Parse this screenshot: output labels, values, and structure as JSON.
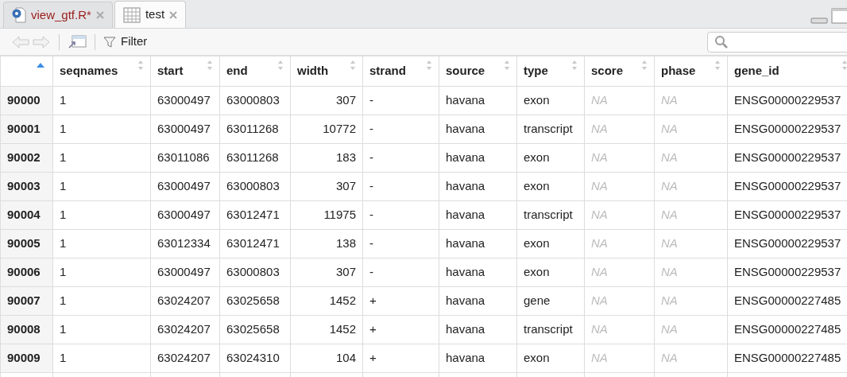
{
  "tabs": [
    {
      "kind": "script",
      "label": "view_gtf.R*",
      "selected": false
    },
    {
      "kind": "table",
      "label": "test",
      "selected": true
    }
  ],
  "toolbar": {
    "filter_label": "Filter"
  },
  "table": {
    "sorted_ascending": true,
    "columns": [
      {
        "label": "seqnames",
        "kind": "text"
      },
      {
        "label": "start",
        "kind": "text"
      },
      {
        "label": "end",
        "kind": "text"
      },
      {
        "label": "width",
        "kind": "number"
      },
      {
        "label": "strand",
        "kind": "text"
      },
      {
        "label": "source",
        "kind": "text"
      },
      {
        "label": "type",
        "kind": "text"
      },
      {
        "label": "score",
        "kind": "na"
      },
      {
        "label": "phase",
        "kind": "na"
      },
      {
        "label": "gene_id",
        "kind": "text"
      }
    ],
    "rows": [
      {
        "name": "90000",
        "cells": [
          "1",
          "63000497",
          "63000803",
          "307",
          "-",
          "havana",
          "exon",
          "NA",
          "NA",
          "ENSG00000229537"
        ]
      },
      {
        "name": "90001",
        "cells": [
          "1",
          "63000497",
          "63011268",
          "10772",
          "-",
          "havana",
          "transcript",
          "NA",
          "NA",
          "ENSG00000229537"
        ]
      },
      {
        "name": "90002",
        "cells": [
          "1",
          "63011086",
          "63011268",
          "183",
          "-",
          "havana",
          "exon",
          "NA",
          "NA",
          "ENSG00000229537"
        ]
      },
      {
        "name": "90003",
        "cells": [
          "1",
          "63000497",
          "63000803",
          "307",
          "-",
          "havana",
          "exon",
          "NA",
          "NA",
          "ENSG00000229537"
        ]
      },
      {
        "name": "90004",
        "cells": [
          "1",
          "63000497",
          "63012471",
          "11975",
          "-",
          "havana",
          "transcript",
          "NA",
          "NA",
          "ENSG00000229537"
        ]
      },
      {
        "name": "90005",
        "cells": [
          "1",
          "63012334",
          "63012471",
          "138",
          "-",
          "havana",
          "exon",
          "NA",
          "NA",
          "ENSG00000229537"
        ]
      },
      {
        "name": "90006",
        "cells": [
          "1",
          "63000497",
          "63000803",
          "307",
          "-",
          "havana",
          "exon",
          "NA",
          "NA",
          "ENSG00000229537"
        ]
      },
      {
        "name": "90007",
        "cells": [
          "1",
          "63024207",
          "63025658",
          "1452",
          "+",
          "havana",
          "gene",
          "NA",
          "NA",
          "ENSG00000227485"
        ]
      },
      {
        "name": "90008",
        "cells": [
          "1",
          "63024207",
          "63025658",
          "1452",
          "+",
          "havana",
          "transcript",
          "NA",
          "NA",
          "ENSG00000227485"
        ]
      },
      {
        "name": "90009",
        "cells": [
          "1",
          "63024207",
          "63024310",
          "104",
          "+",
          "havana",
          "exon",
          "NA",
          "NA",
          "ENSG00000227485"
        ]
      }
    ]
  }
}
